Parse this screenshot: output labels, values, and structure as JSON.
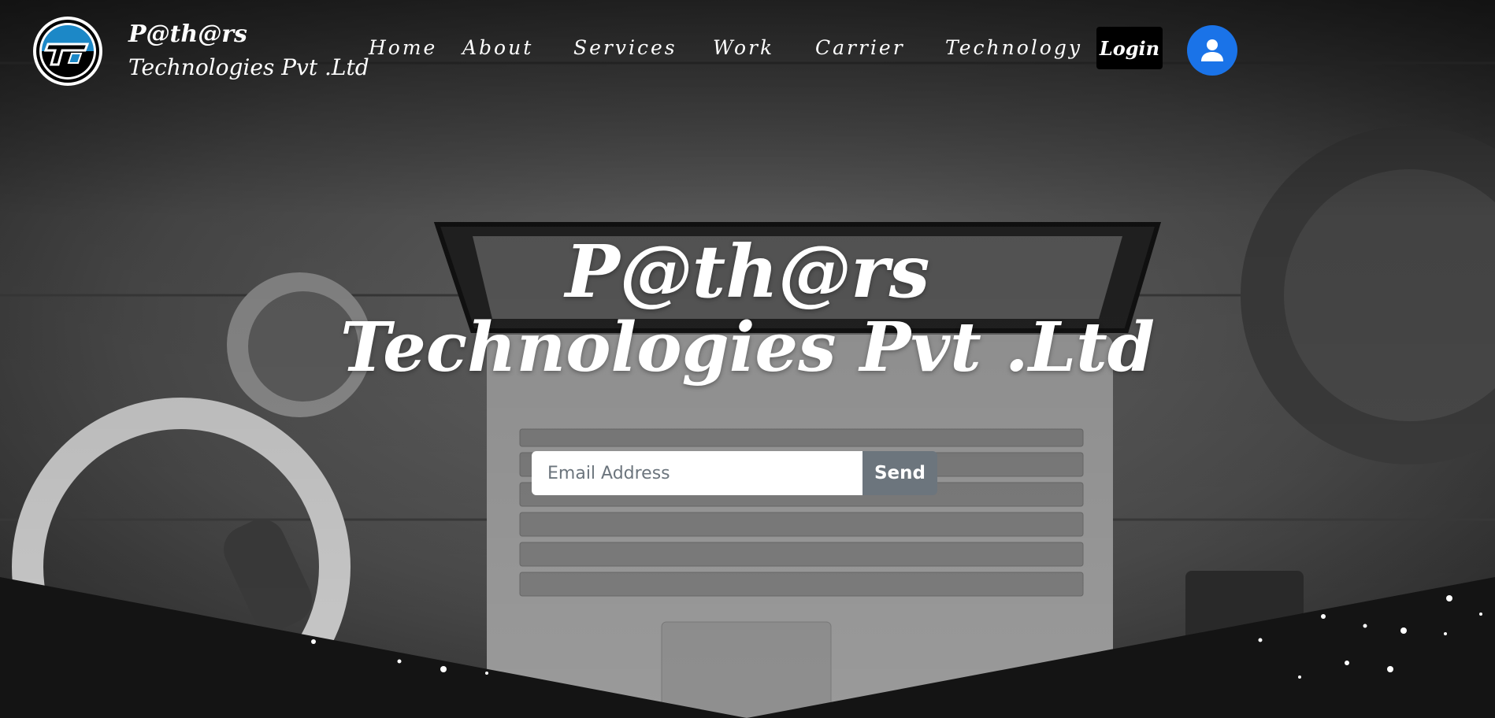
{
  "brand": {
    "name_line1": "P@th@rs",
    "name_line2": "Technologies Pvt .Ltd"
  },
  "nav": {
    "items": [
      {
        "label": "Home"
      },
      {
        "label": "About"
      },
      {
        "label": "Services"
      },
      {
        "label": "Work"
      },
      {
        "label": "Carrier"
      },
      {
        "label": "Technology"
      }
    ],
    "login_label": "Login",
    "user_icon": "user-icon"
  },
  "hero": {
    "title_line1": "P@th@rs",
    "title_line2": "Technologies Pvt .Ltd"
  },
  "subscribe": {
    "email_placeholder": "Email Address",
    "email_value": "",
    "send_label": "Send"
  },
  "colors": {
    "avatar_bg": "#1a73e8",
    "send_bg": "#6c757d",
    "login_bg": "#000000",
    "logo_accent": "#1c88c7"
  }
}
